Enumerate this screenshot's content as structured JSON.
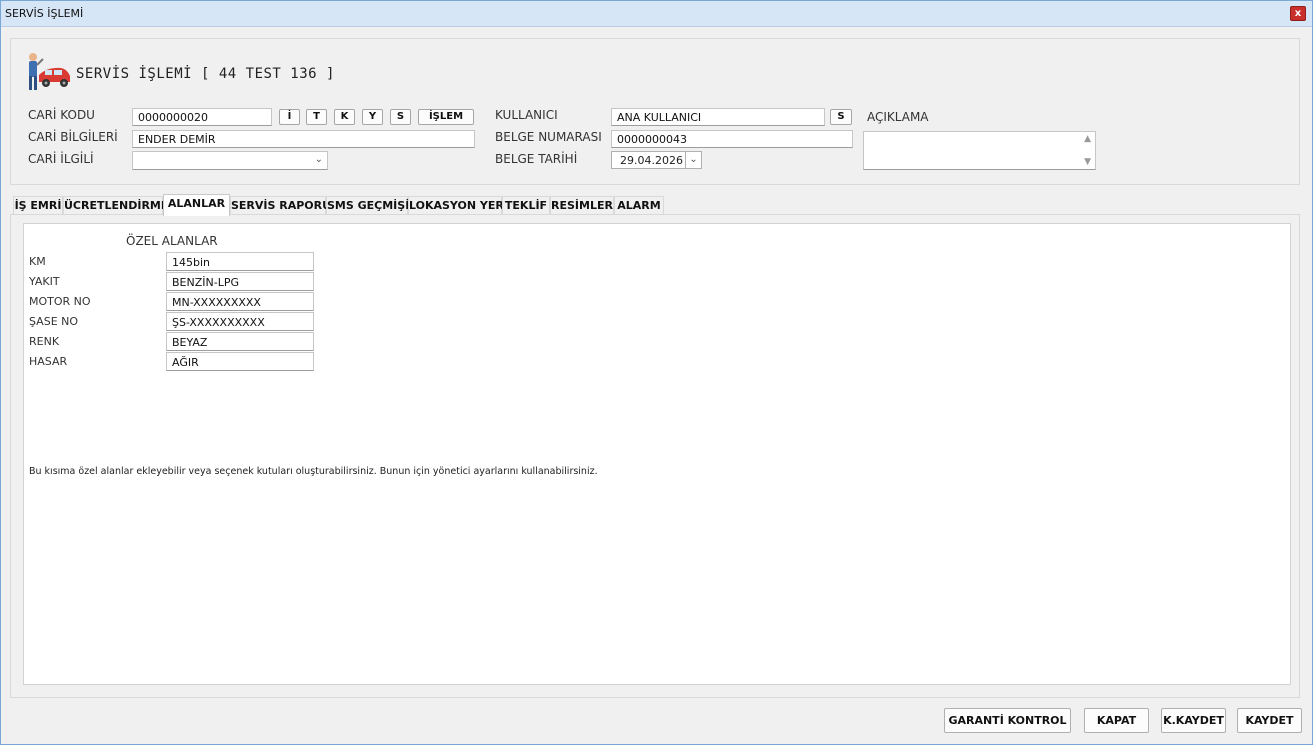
{
  "window": {
    "title": "SERVİS İŞLEMİ",
    "close_label": "x"
  },
  "header": {
    "title": "SERVİS İŞLEMİ [ 44 TEST 136 ]",
    "logo_icon": "mechanic-car-icon"
  },
  "form": {
    "cari_kodu_label": "CARİ KODU",
    "cari_kodu_value": "0000000020",
    "cari_buttons": [
      "İ",
      "T",
      "K",
      "Y",
      "S",
      "İŞLEM"
    ],
    "cari_bilgileri_label": "CARİ BİLGİLERİ",
    "cari_bilgileri_value": "ENDER DEMİR",
    "cari_ilgili_label": "CARİ İLGİLİ",
    "cari_ilgili_value": "",
    "kullanici_label": "KULLANICI",
    "kullanici_value": "ANA KULLANICI",
    "kullanici_button": "S",
    "belge_numarasi_label": "BELGE NUMARASI",
    "belge_numarasi_value": "0000000043",
    "belge_tarihi_label": "BELGE TARİHİ",
    "belge_tarihi_value": "29.04.2026",
    "aciklama_label": "AÇIKLAMA",
    "aciklama_value": ""
  },
  "tabs": [
    {
      "label": "İŞ EMRİ",
      "active": false
    },
    {
      "label": "ÜCRETLENDİRME",
      "active": false
    },
    {
      "label": "ALANLAR",
      "active": true
    },
    {
      "label": "SERVİS RAPORU",
      "active": false
    },
    {
      "label": "SMS GEÇMİŞİ",
      "active": false
    },
    {
      "label": "LOKASYON YERİ",
      "active": false
    },
    {
      "label": "TEKLİF",
      "active": false
    },
    {
      "label": "RESİMLER",
      "active": false
    },
    {
      "label": "ALARM",
      "active": false
    }
  ],
  "alanlar": {
    "section_title": "ÖZEL ALANLAR",
    "fields": [
      {
        "label": "KM",
        "value": "145bin"
      },
      {
        "label": "YAKIT",
        "value": "BENZİN-LPG"
      },
      {
        "label": "MOTOR NO",
        "value": "MN-XXXXXXXXX"
      },
      {
        "label": "ŞASE NO",
        "value": "ŞS-XXXXXXXXXX"
      },
      {
        "label": "RENK",
        "value": "BEYAZ"
      },
      {
        "label": "HASAR",
        "value": "AĞIR"
      }
    ],
    "note": "Bu kısıma özel alanlar ekleyebilir veya seçenek kutuları oluşturabilirsiniz. Bunun için yönetici ayarlarını kullanabilirsiniz."
  },
  "footer_buttons": {
    "garanti": "GARANTİ KONTROL",
    "kapat": "KAPAT",
    "kkaydet": "K.KAYDET",
    "kaydet": "KAYDET"
  }
}
